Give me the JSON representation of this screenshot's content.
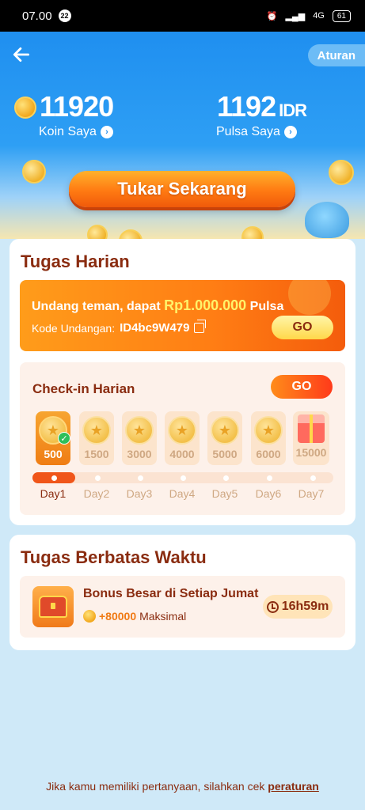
{
  "status_bar": {
    "time": "07.00",
    "notif_count": "22",
    "network": "4G",
    "battery": "61"
  },
  "header": {
    "back_icon": "arrow-left-icon",
    "rules_label": "Aturan"
  },
  "stats": {
    "coins_value": "11920",
    "coins_label": "Koin Saya",
    "pulsa_value": "1192",
    "pulsa_unit": "IDR",
    "pulsa_label": "Pulsa Saya"
  },
  "cta": {
    "exchange_label": "Tukar Sekarang"
  },
  "daily_tasks": {
    "title": "Tugas Harian",
    "invite": {
      "text_prefix": "Undang teman, dapat ",
      "amount": "Rp1.000.000",
      "text_suffix": " Pulsa",
      "code_label": "Kode Undangan:",
      "code": "ID4bc9W479",
      "go_label": "GO"
    },
    "checkin": {
      "title": "Check-in Harian",
      "go_label": "GO",
      "days": [
        {
          "value": "500",
          "label": "Day1"
        },
        {
          "value": "1500",
          "label": "Day2"
        },
        {
          "value": "3000",
          "label": "Day3"
        },
        {
          "value": "4000",
          "label": "Day4"
        },
        {
          "value": "5000",
          "label": "Day5"
        },
        {
          "value": "6000",
          "label": "Day6"
        },
        {
          "value": "15000",
          "label": "Day7"
        }
      ],
      "completed_days": 1
    }
  },
  "limited_tasks": {
    "title": "Tugas Berbatas Waktu",
    "item": {
      "title": "Bonus Besar di Setiap Jumat",
      "bonus": "+80000",
      "bonus_suffix": "Maksimal",
      "timer": "16h59m"
    }
  },
  "footer": {
    "text": "Jika kamu memiliki pertanyaan, silahkan cek ",
    "link": "peraturan"
  },
  "colors": {
    "primary_blue": "#1f8ff0",
    "orange": "#ff7a12",
    "dark_brown": "#8a2c10"
  }
}
